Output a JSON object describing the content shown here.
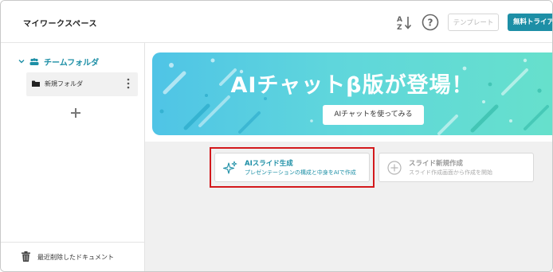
{
  "header": {
    "workspace_title": "マイワークスペース",
    "template_label": "テンプレート",
    "trial_label": "無料トライアル",
    "sort_icon": "sort-az-icon",
    "help_icon": "help-icon"
  },
  "sidebar": {
    "team_folder_label": "チームフォルダ",
    "folders": [
      {
        "label": "新規フォルダ"
      }
    ],
    "trash_label": "最近削除したドキュメント"
  },
  "banner": {
    "title": "AIチャットβ版が登場！",
    "button_label": "AIチャットを使ってみる"
  },
  "cards": {
    "ai": {
      "title": "AIスライド生成",
      "subtitle": "プレゼンテーションの構成と中身をAIで作成"
    },
    "new": {
      "title": "スライド新規作成",
      "subtitle": "スライド作成画面から作成を開始"
    }
  },
  "colors": {
    "accent": "#1d8fa6",
    "highlight": "#d3191c",
    "banner_start": "#4fc4e6",
    "banner_end": "#66e0cc"
  }
}
